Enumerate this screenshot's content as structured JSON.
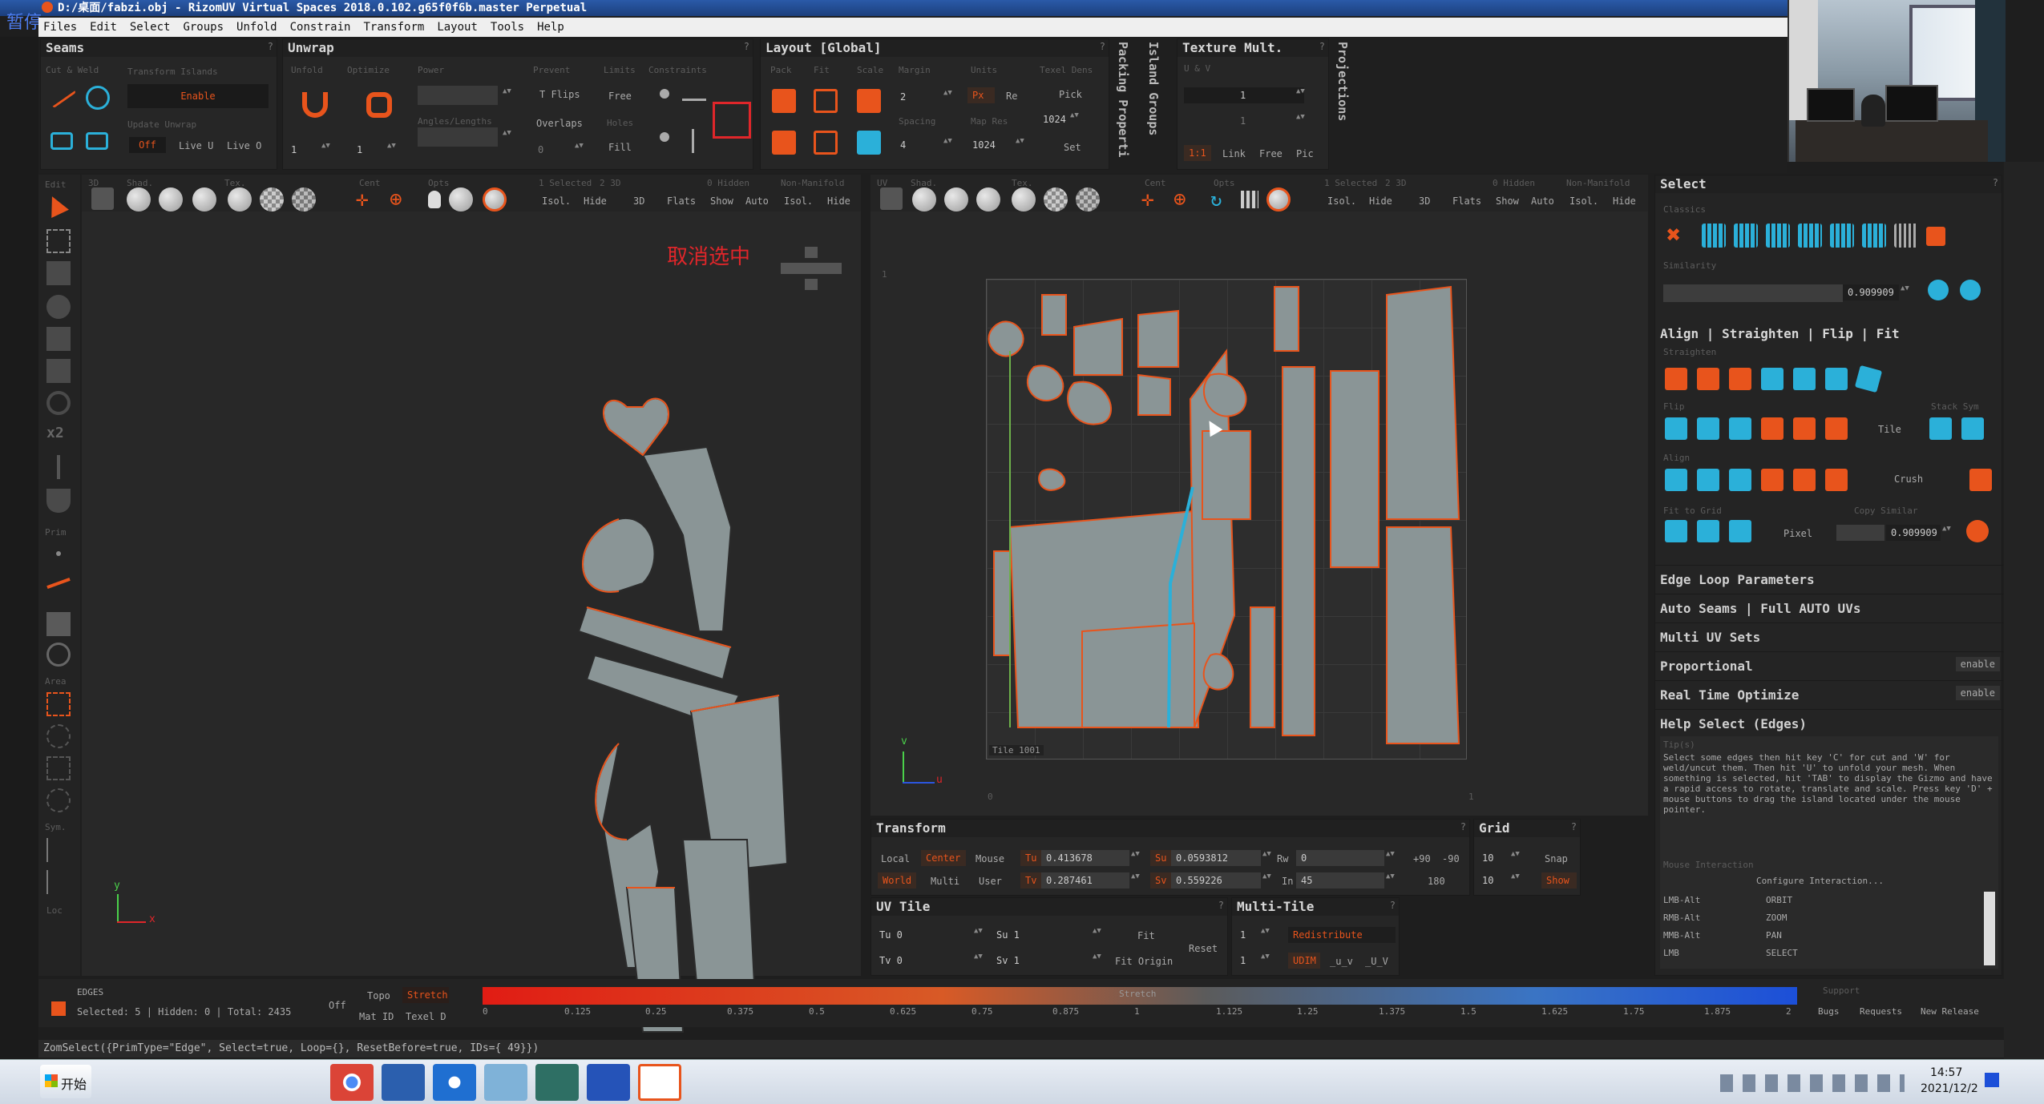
{
  "window": {
    "title": "D:/桌面/fabzi.obj - RizomUV  Virtual Spaces 2018.0.102.g65f0f6b.master Perpetual",
    "overlay_label": "暂停"
  },
  "menu": [
    "Files",
    "Edit",
    "Select",
    "Groups",
    "Unfold",
    "Constrain",
    "Transform",
    "Layout",
    "Tools",
    "Help"
  ],
  "seams": {
    "title": "Seams",
    "cut_weld": "Cut & Weld",
    "transform_islands": "Transform Islands",
    "enable": "Enable",
    "update_unwrap": "Update Unwrap",
    "off": "Off",
    "live_u": "Live U",
    "live_o": "Live O"
  },
  "unwrap": {
    "title": "Unwrap",
    "unfold": "Unfold",
    "optimize": "Optimize",
    "power": "Power",
    "prevent": "Prevent",
    "limits": "Limits",
    "constraints": "Constraints",
    "t_flips": "T Flips",
    "free": "Free",
    "overlaps": "Overlaps",
    "holes": "Holes",
    "fill": "Fill",
    "angles_lengths": "Angles/Lengths",
    "v1": "1",
    "v2": "1",
    "v3": "0"
  },
  "layout": {
    "title": "Layout [Global]",
    "pack": "Pack",
    "fit": "Fit",
    "scale": "Scale",
    "margin": "Margin",
    "units": "Units",
    "texel_dens": "Texel Dens",
    "margin_val": "2",
    "px": "Px",
    "re": "Re",
    "pick": "Pick",
    "spacing": "Spacing",
    "map_res": "Map Res",
    "spacing_val": "4",
    "map_res_val": "1024",
    "map_res_val2": "1024",
    "set": "Set"
  },
  "side_tabs": {
    "packing": "Packing Properti",
    "island_groups": "Island Groups",
    "projections": "Projections"
  },
  "texture_mult": {
    "title": "Texture Mult.",
    "uv": "U & V",
    "u_val": "1",
    "v_val": "1",
    "ratio": "1:1",
    "link": "Link",
    "free": "Free",
    "pic": "Pic"
  },
  "view3d": {
    "edit": "Edit",
    "tab3d": "3D",
    "shad": "Shad.",
    "tex": "Tex.",
    "cent": "Cent",
    "opts": "Opts",
    "selected": "1 Selected",
    "twod": "2 3D",
    "hidden": "0 Hidden",
    "non_manifold": "Non-Manifold",
    "isol": "Isol.",
    "hide": "Hide",
    "b3d": "3D",
    "flats": "Flats",
    "show": "Show",
    "auto": "Auto",
    "isol2": "Isol.",
    "hide2": "Hide",
    "deselect_label": "取消选中",
    "axis_y": "y",
    "axis_x": "x"
  },
  "tool_labels": {
    "prim": "Prim",
    "area": "Area",
    "sym": "Sym.",
    "loc": "Loc"
  },
  "viewuv": {
    "uv": "UV",
    "shad": "Shad.",
    "tex": "Tex.",
    "cent": "Cent",
    "opts": "Opts",
    "selected": "1 Selected",
    "twod": "2 3D",
    "hidden": "0 Hidden",
    "non_manifold": "Non-Manifold",
    "isol": "Isol.",
    "hide": "Hide",
    "b3d": "3D",
    "flats": "Flats",
    "show": "Show",
    "auto": "Auto",
    "isol2": "Isol.",
    "hide2": "Hide",
    "tile": "Tile 1001",
    "axis_v": "v",
    "axis_u": "u",
    "tick0": "0",
    "tick1": "1",
    "tick1y": "1"
  },
  "transform": {
    "title": "Transform",
    "local": "Local",
    "center": "Center",
    "mouse": "Mouse",
    "world": "World",
    "multi": "Multi",
    "user": "User",
    "tu": "Tu",
    "tv": "Tv",
    "tu_val": "0.413678",
    "tv_val": "0.287461",
    "su": "Su",
    "sv": "Sv",
    "su_val": "0.0593812",
    "sv_val": "0.559226",
    "rw": "Rw",
    "rw_val": "0",
    "in": "In",
    "in_val": "45",
    "p90": "+90",
    "m90": "-90",
    "r180": "180"
  },
  "grid": {
    "title": "Grid",
    "v1": "10",
    "v2": "10",
    "snap": "Snap",
    "show": "Show"
  },
  "uvtile": {
    "title": "UV Tile",
    "tu": "Tu 0",
    "tv": "Tv 0",
    "su": "Su 1",
    "sv": "Sv 1",
    "fit": "Fit",
    "fit_origin": "Fit Origin",
    "reset": "Reset"
  },
  "multitile": {
    "title": "Multi-Tile",
    "v1": "1",
    "v2": "1",
    "redistribute": "Redistribute",
    "udim": "UDIM",
    "u_v": "_u_v",
    "UV": "_U_V"
  },
  "select_panel": {
    "title": "Select",
    "classics": "Classics",
    "similarity": "Similarity",
    "sim_val": "0.909909",
    "align_header": "Align | Straighten | Flip | Fit",
    "straighten": "Straighten",
    "flip": "Flip",
    "tile": "Tile",
    "stack_sym": "Stack Sym",
    "align": "Align",
    "crush": "Crush",
    "fit_to_grid": "Fit to Grid",
    "copy_similar": "Copy Similar",
    "pixel": "Pixel",
    "copy_val": "0.909909"
  },
  "sections": [
    {
      "label": "Edge Loop Parameters",
      "btn": ""
    },
    {
      "label": "Auto Seams | Full AUTO UVs",
      "btn": ""
    },
    {
      "label": "Multi UV Sets",
      "btn": ""
    },
    {
      "label": "Proportional",
      "btn": "enable"
    },
    {
      "label": "Real Time Optimize",
      "btn": "enable"
    },
    {
      "label": "Help Select (Edges)",
      "btn": ""
    }
  ],
  "help": {
    "tips_label": "Tip(s)",
    "text": "Select some edges then hit key 'C' for cut and 'W' for weld/uncut them. Then hit 'U' to unfold your mesh. When something is selected, hit 'TAB' to display the Gizmo and have a rapid access to rotate, translate and scale. Press key 'D' + mouse buttons to drag the island located under the mouse pointer.",
    "mouse_interaction": "Mouse Interaction",
    "configure": "Configure Interaction...",
    "bindings": [
      {
        "k": "LMB-Alt",
        "v": "ORBIT"
      },
      {
        "k": "RMB-Alt",
        "v": "ZOOM"
      },
      {
        "k": "MMB-Alt",
        "v": "PAN"
      },
      {
        "k": "LMB",
        "v": "SELECT"
      }
    ]
  },
  "status": {
    "mode": "EDGES",
    "counts": "Selected: 5 | Hidden: 0 | Total: 2435",
    "off": "Off",
    "topo": "Topo",
    "stretch_btn": "Stretch",
    "mat_id": "Mat ID",
    "texel_d": "Texel D",
    "stretch_label": "Stretch",
    "ticks": [
      "0",
      "0.125",
      "0.25",
      "0.375",
      "0.5",
      "0.625",
      "0.75",
      "0.875",
      "1",
      "1.125",
      "1.25",
      "1.375",
      "1.5",
      "1.625",
      "1.75",
      "1.875",
      "2"
    ],
    "support": "Support",
    "bugs": "Bugs",
    "requests": "Requests",
    "new_release": "New Release"
  },
  "cmdline": "ZomSelect({PrimType=\"Edge\", Select=true, Loop={}, ResetBefore=true, IDs={ 49}})",
  "taskbar": {
    "start": "开始",
    "time": "14:57",
    "date": "2021/12/2"
  },
  "colors": {
    "accent": "#e8541c",
    "select_blue": "#2bb0d9",
    "panel": "#262626",
    "deselect_red": "#e0262a"
  }
}
